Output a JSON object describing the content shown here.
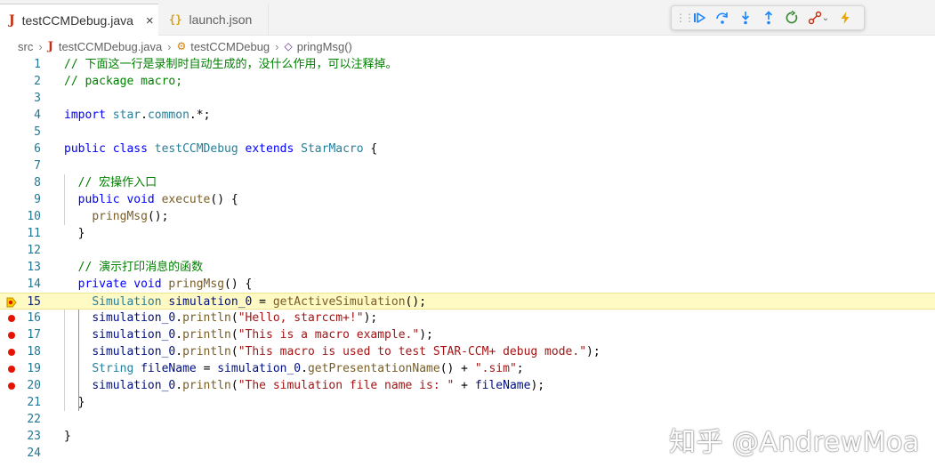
{
  "tabs": [
    {
      "icon": "J",
      "label": "testCCMDebug.java",
      "close": "×"
    },
    {
      "icon": "{}",
      "label": "launch.json"
    }
  ],
  "breadcrumb": {
    "items": [
      "src",
      "testCCMDebug.java",
      "testCCMDebug",
      "pringMsg()"
    ]
  },
  "debug_toolbar": {
    "buttons": [
      "continue-icon",
      "step-over-icon",
      "step-into-icon",
      "step-out-icon",
      "restart-icon",
      "disconnect-icon",
      "hot-code-replace-icon"
    ],
    "colors": {
      "accent": "#1a85ff",
      "restart": "#388a34",
      "disconnect": "#c72e0f",
      "hot": "#e8a600"
    }
  },
  "editor": {
    "current_line": 15,
    "breakpoints": [
      16,
      17,
      18,
      19,
      20
    ],
    "lines": [
      {
        "n": "1",
        "text": "// 下面这一行是录制时自动生成的，没什么作用，可以注释掉。"
      },
      {
        "n": "2",
        "text": "// package macro;"
      },
      {
        "n": "3",
        "text": ""
      },
      {
        "n": "4",
        "text": "import star.common.*;"
      },
      {
        "n": "5",
        "text": ""
      },
      {
        "n": "6",
        "text": "public class testCCMDebug extends StarMacro {"
      },
      {
        "n": "7",
        "text": ""
      },
      {
        "n": "8",
        "text": "  // 宏操作入口"
      },
      {
        "n": "9",
        "text": "  public void execute() {"
      },
      {
        "n": "10",
        "text": "    pringMsg();"
      },
      {
        "n": "11",
        "text": "  }"
      },
      {
        "n": "12",
        "text": ""
      },
      {
        "n": "13",
        "text": "  // 演示打印消息的函数"
      },
      {
        "n": "14",
        "text": "  private void pringMsg() {"
      },
      {
        "n": "15",
        "text": "    Simulation simulation_0 = getActiveSimulation();"
      },
      {
        "n": "16",
        "text": "    simulation_0.println(\"Hello, starccm+!\");"
      },
      {
        "n": "17",
        "text": "    simulation_0.println(\"This is a macro example.\");"
      },
      {
        "n": "18",
        "text": "    simulation_0.println(\"This macro is used to test STAR-CCM+ debug mode.\");"
      },
      {
        "n": "19",
        "text": "    String fileName = simulation_0.getPresentationName() + \".sim\";"
      },
      {
        "n": "20",
        "text": "    simulation_0.println(\"The simulation file name is: \" + fileName);"
      },
      {
        "n": "21",
        "text": "  }"
      },
      {
        "n": "22",
        "text": ""
      },
      {
        "n": "23",
        "text": "}"
      },
      {
        "n": "24",
        "text": ""
      }
    ]
  },
  "watermark": "知乎 @AndrewMoa"
}
